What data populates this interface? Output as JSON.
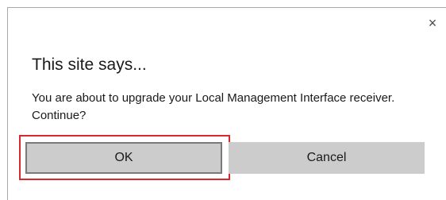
{
  "dialog": {
    "close_glyph": "×",
    "title": "This site says...",
    "message": "You are about to upgrade your Local Management Interface receiver. Continue?",
    "buttons": {
      "ok_label": "OK",
      "cancel_label": "Cancel"
    },
    "focused_button": "OK"
  },
  "colors": {
    "highlight": "#d9282e",
    "button_bg": "#cccccc",
    "focused_border": "#7a7a7a"
  }
}
